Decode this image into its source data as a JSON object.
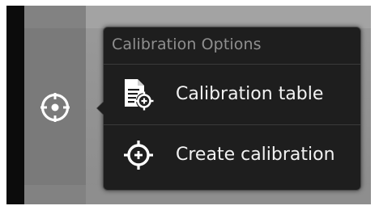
{
  "popup": {
    "title": "Calibration Options",
    "items": [
      {
        "label": "Calibration table",
        "icon": "calibration-table-icon"
      },
      {
        "label": "Create calibration",
        "icon": "crosshair-plus-icon"
      }
    ]
  },
  "sidebar": {
    "calibration_button_icon": "crosshair-icon"
  },
  "colors": {
    "popup_background": "#1e1e1e",
    "title_text": "#8f8f8f",
    "item_text": "#f2f2f2",
    "icon_white": "#ffffff"
  }
}
